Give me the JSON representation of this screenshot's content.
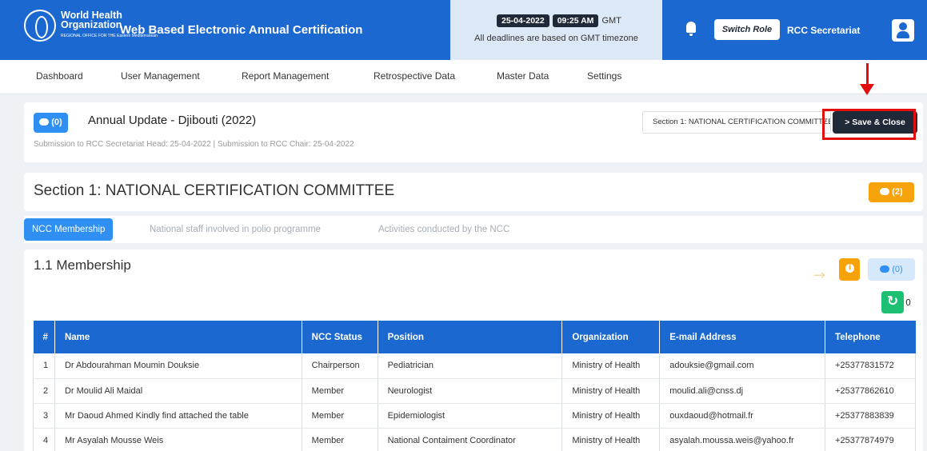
{
  "header": {
    "logo_line1": "World Health",
    "logo_line2": "Organization",
    "logo_line3": "REGIONAL OFFICE FOR THE Eastern Mediterranean",
    "app_title": "Web Based Electronic Annual Certification",
    "date": "25-04-2022",
    "time": "09:25 AM",
    "timezone": "GMT",
    "timezone_note": "All deadlines are based on GMT timezone",
    "switch_role_label": "Switch Role",
    "role_name": "RCC Secretariat"
  },
  "nav": {
    "items": [
      "Dashboard",
      "User Management",
      "Report Management",
      "Retrospective Data",
      "Master Data",
      "Settings"
    ]
  },
  "report": {
    "comment_count": "(0)",
    "title": "Annual Update - Djibouti (2022)",
    "submission_line": "Submission to RCC Secretariat Head: 25-04-2022 | Submission to RCC Chair: 25-04-2022",
    "section_select_value": "Section 1: NATIONAL CERTIFICATION COMMITTEE",
    "save_close_label": "> Save & Close"
  },
  "section": {
    "title": "Section 1: NATIONAL CERTIFICATION COMMITTEE",
    "comment_count": "(2)"
  },
  "tabs": [
    "NCC Membership",
    "National staff involved in polio programme",
    "Activities conducted by the NCC"
  ],
  "membership": {
    "title": "1.1 Membership",
    "comment_count": "(0)",
    "refresh_count": "0",
    "columns": [
      "#",
      "Name",
      "NCC Status",
      "Position",
      "Organization",
      "E-mail Address",
      "Telephone"
    ],
    "rows": [
      [
        "1",
        "Dr Abdourahman Moumin Douksie",
        "Chairperson",
        "Pediatrician",
        "Ministry of Health",
        "adouksie@gmail.com",
        "+25377831572"
      ],
      [
        "2",
        "Dr Moulid Ali Maidal",
        "Member",
        "Neurologist",
        "Ministry of Health",
        "moulid.ali@cnss.dj",
        "+25377862610"
      ],
      [
        "3",
        "Mr Daoud Ahmed Kindly find attached the table",
        "Member",
        "Epidemiologist",
        "Ministry of Health",
        "ouxdaoud@hotmail.fr",
        "+25377883839"
      ],
      [
        "4",
        "Mr Asyalah Mousse Weis",
        "Member",
        "National Contaiment Coordinator",
        "Ministry of Health",
        "asyalah.moussa.weis@yahoo.fr",
        "+25377874979"
      ]
    ]
  },
  "colors": {
    "primary": "#1b69d0",
    "accent_blue": "#2f8ff2",
    "orange": "#f5a20b",
    "green": "#1dbf73",
    "dark": "#1f2937",
    "highlight": "#e20e0e"
  }
}
